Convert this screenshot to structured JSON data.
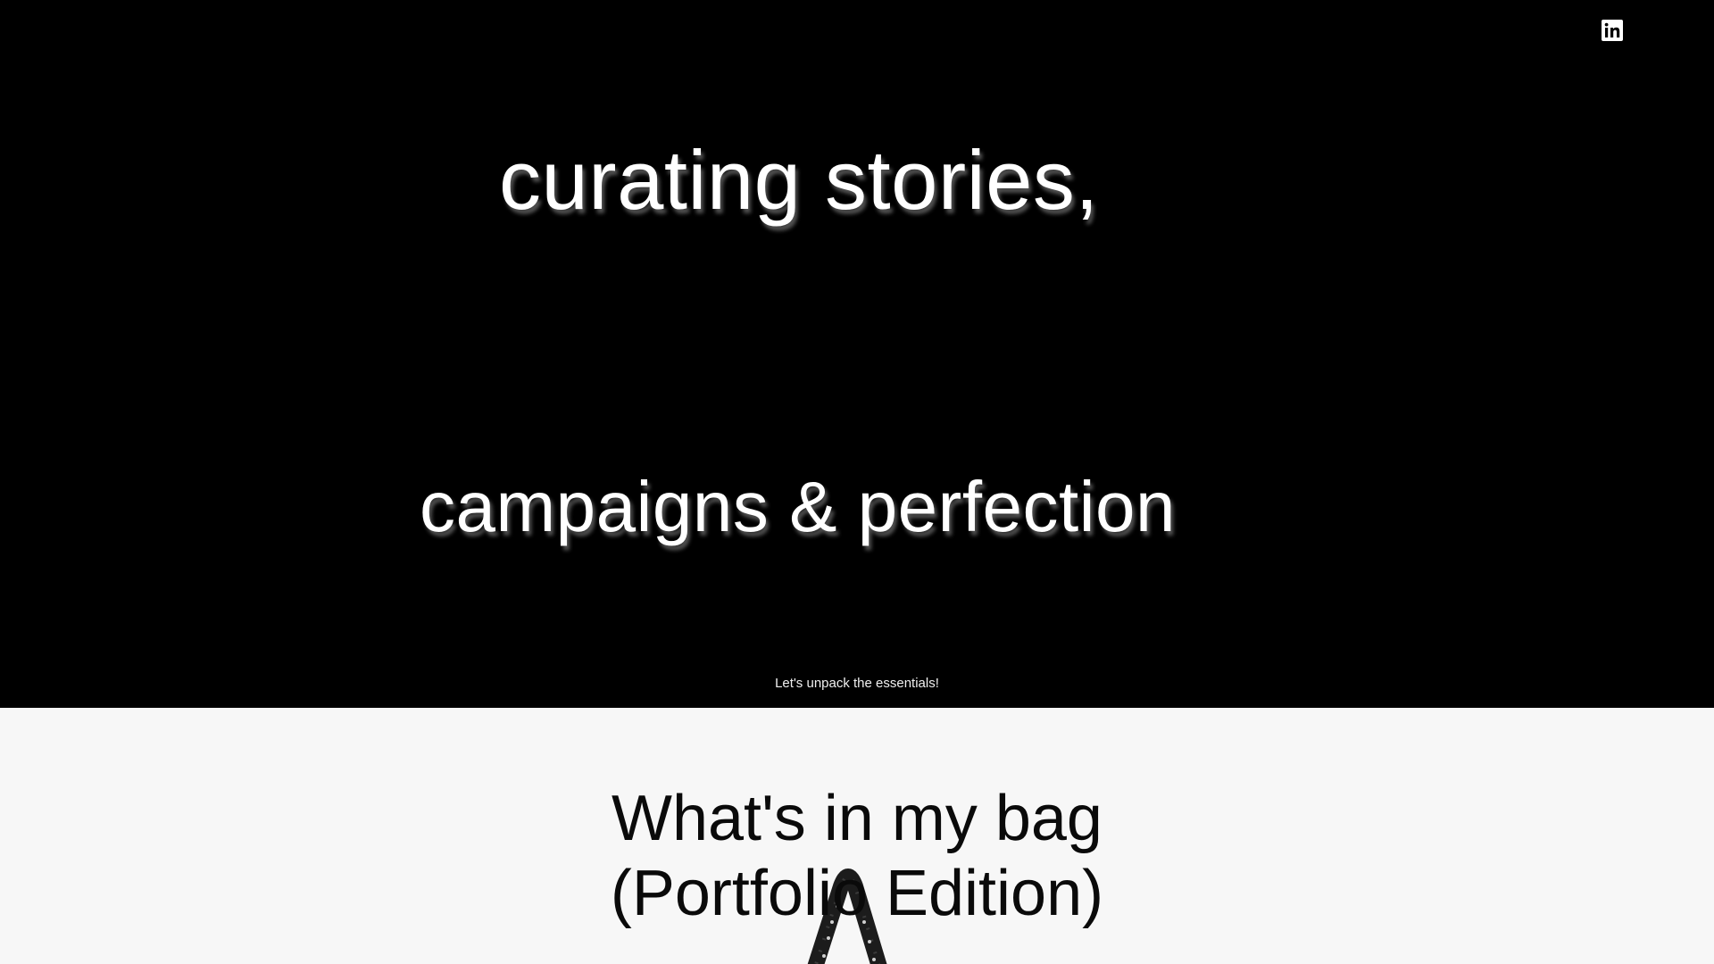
{
  "header": {
    "social_icon": "linkedin-icon"
  },
  "hero": {
    "line1": "curating stories,",
    "line2": "campaigns & perfection",
    "subtitle": "Let's unpack the essentials!"
  },
  "bag_section": {
    "title_line1": "What's in my bag",
    "title_line2": "(Portfolio Edition)",
    "image_icon": "tote-bag-image"
  },
  "colors": {
    "hero_background": "#000000",
    "hero_text": "#ffffff",
    "section_background": "#f7f7f7",
    "section_text": "#0a0a0a"
  }
}
